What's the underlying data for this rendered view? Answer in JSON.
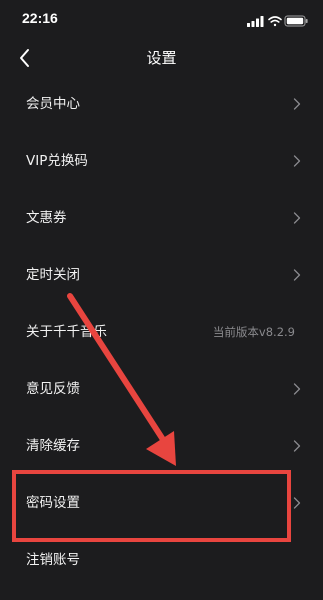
{
  "status_bar": {
    "time": "22:16"
  },
  "nav": {
    "title": "设置"
  },
  "settings": {
    "items": [
      {
        "label": "会员中心"
      },
      {
        "label": "VIP兑换码"
      },
      {
        "label": "文惠券"
      },
      {
        "label": "定时关闭"
      },
      {
        "label": "关于千千音乐",
        "value": "当前版本v8.2.9"
      },
      {
        "label": "意见反馈"
      },
      {
        "label": "清除缓存"
      },
      {
        "label": "密码设置"
      },
      {
        "label": "注销账号"
      }
    ]
  },
  "colors": {
    "background": "#1c1c1e",
    "annotation": "#e8453f",
    "secondary_text": "#8a8a8e"
  }
}
